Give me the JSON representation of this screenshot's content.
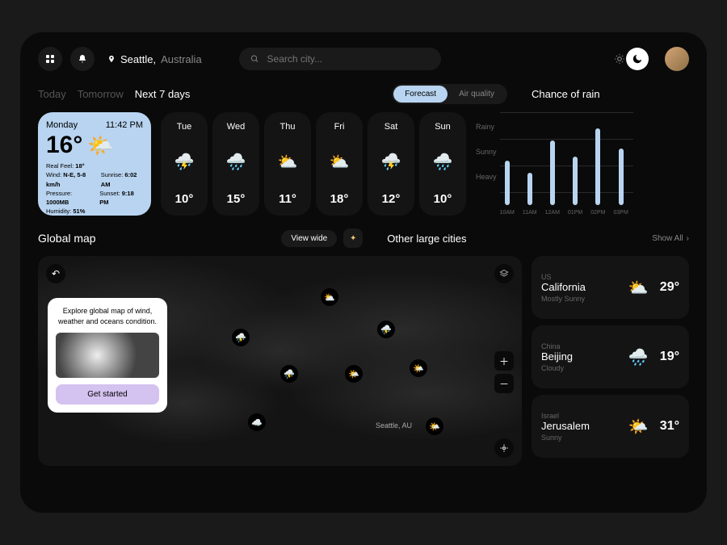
{
  "header": {
    "location_city": "Seattle,",
    "location_country": "Australia",
    "search_placeholder": "Search city..."
  },
  "tabs": {
    "today": "Today",
    "tomorrow": "Tomorrow",
    "next7": "Next 7 days",
    "active": "next7"
  },
  "pills": {
    "forecast": "Forecast",
    "airquality": "Air quality"
  },
  "rain_title": "Chance of rain",
  "today_card": {
    "day": "Monday",
    "time": "11:42 PM",
    "temp": "16°",
    "real_feel_label": "Real Feel:",
    "real_feel": "18°",
    "wind_label": "Wind:",
    "wind": "N-E, 5-8 km/h",
    "pressure_label": "Pressure:",
    "pressure": "1000MB",
    "humidity_label": "Humidity:",
    "humidity": "51%",
    "sunrise_label": "Sunrise:",
    "sunrise": "6:02 AM",
    "sunset_label": "Sunset:",
    "sunset": "9:18 PM"
  },
  "forecast": [
    {
      "day": "Tue",
      "icon": "⛈️",
      "temp": "10°"
    },
    {
      "day": "Wed",
      "icon": "🌧️",
      "temp": "15°"
    },
    {
      "day": "Thu",
      "icon": "⛅",
      "temp": "11°"
    },
    {
      "day": "Fri",
      "icon": "⛅",
      "temp": "18°"
    },
    {
      "day": "Sat",
      "icon": "⛈️",
      "temp": "12°"
    },
    {
      "day": "Sun",
      "icon": "🌧️",
      "temp": "10°"
    }
  ],
  "chart_data": {
    "type": "bar",
    "y_labels": [
      "Rainy",
      "Sunny",
      "Heavy"
    ],
    "categories": [
      "10AM",
      "11AM",
      "12AM",
      "01PM",
      "02PM",
      "03PM"
    ],
    "values": [
      55,
      40,
      80,
      60,
      95,
      70
    ],
    "ylim": [
      0,
      100
    ]
  },
  "map": {
    "title": "Global map",
    "view_wide": "View wide",
    "location_label": "Seattle, AU",
    "promo_text": "Explore global map of wind, weather and oceans condition.",
    "promo_cta": "Get started"
  },
  "cities": {
    "title": "Other large cities",
    "show_all": "Show All",
    "items": [
      {
        "country": "US",
        "name": "California",
        "cond": "Mostly Sunny",
        "icon": "⛅",
        "temp": "29°"
      },
      {
        "country": "China",
        "name": "Beijing",
        "cond": "Cloudy",
        "icon": "🌧️",
        "temp": "19°"
      },
      {
        "country": "Israel",
        "name": "Jerusalem",
        "cond": "Sunny",
        "icon": "🌤️",
        "temp": "31°"
      }
    ]
  }
}
